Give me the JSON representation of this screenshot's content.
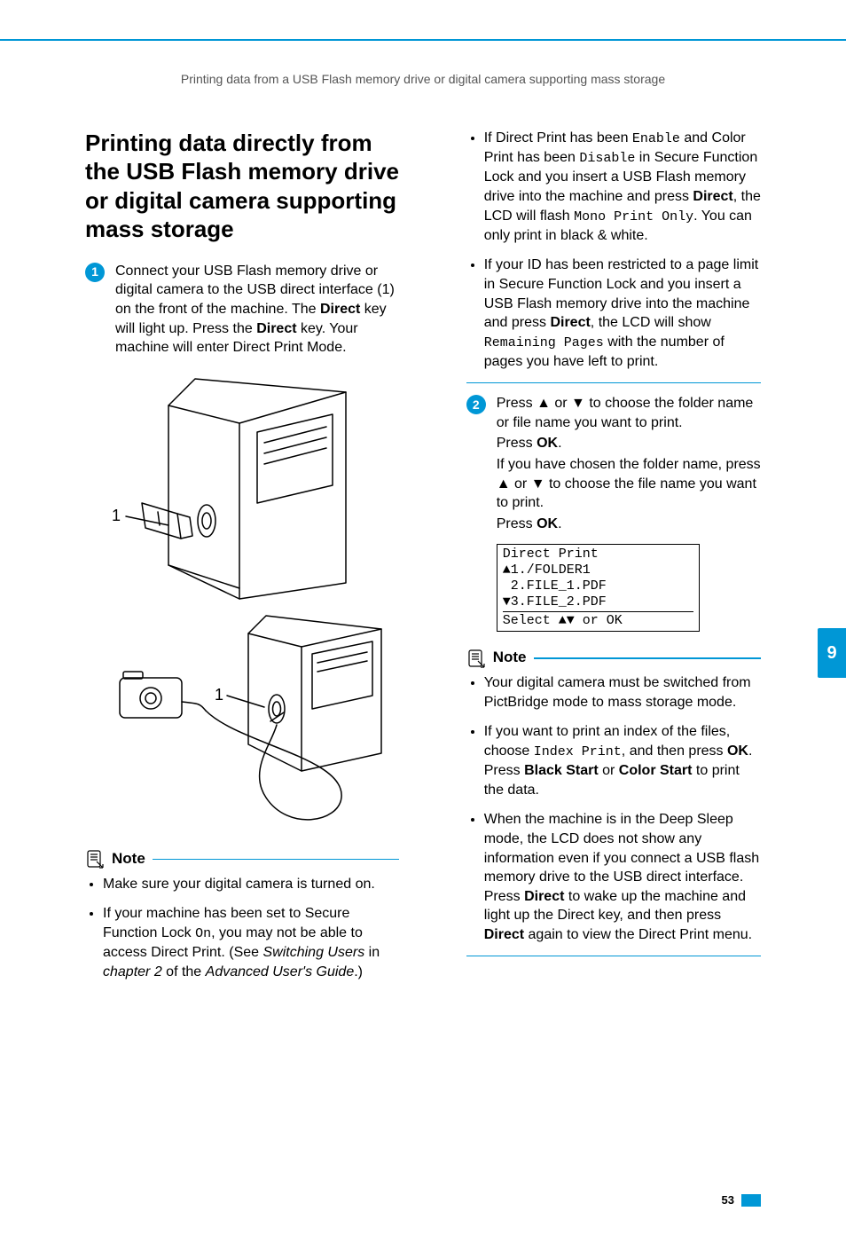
{
  "running_header": "Printing data from a USB Flash memory drive or digital camera supporting mass storage",
  "heading": "Printing data directly from the USB Flash memory drive or digital camera supporting mass storage",
  "step1_a": "Connect your USB Flash memory drive or digital camera to the USB direct interface (1) on the front of the machine. The ",
  "step1_b1": "Direct",
  "step1_c": " key will light up. Press the ",
  "step1_b2": "Direct",
  "step1_d": " key. Your machine will enter Direct Print Mode.",
  "callout_one_a": "1",
  "callout_one_b": "1",
  "note_label": "Note",
  "left_note_b1": "Make sure your digital camera is turned on.",
  "left_note_b2_a": "If your machine has been set to Secure Function Lock ",
  "left_note_b2_on": "On",
  "left_note_b2_b": ", you may not be able to access Direct Print. (See ",
  "left_note_b2_italic1": "Switching Users",
  "left_note_b2_c": " in ",
  "left_note_b2_italic2": "chapter 2",
  "left_note_b2_d": " of the ",
  "left_note_b2_italic3": "Advanced User's Guide",
  "left_note_b2_end": ".)",
  "right_b1_a": "If Direct Print has been ",
  "right_b1_enable": "Enable",
  "right_b1_b": " and Color Print has been ",
  "right_b1_disable": "Disable",
  "right_b1_c": " in Secure Function Lock and you insert a USB Flash memory drive into the machine and press ",
  "right_b1_direct": "Direct",
  "right_b1_d": ", the LCD will flash ",
  "right_b1_mono": "Mono Print Only",
  "right_b1_e": ". You can only print in black & white.",
  "right_b2_a": "If your ID has been restricted to a page limit in Secure Function Lock and you insert a USB Flash memory drive into the machine and press ",
  "right_b2_direct": "Direct",
  "right_b2_b": ", the LCD will show ",
  "right_b2_remain": "Remaining Pages",
  "right_b2_c": " with the number of pages you have left to print.",
  "step2_a": "Press ",
  "step2_up": "a",
  "step2_or1": " or ",
  "step2_down": "b",
  "step2_b": " to choose the folder name or file name you want to print.",
  "step2_press": "Press ",
  "step2_ok": "OK",
  "step2_dot": ".",
  "step2_c": "If you have chosen the folder name, press ",
  "step2_up2": "a",
  "step2_or2": " or ",
  "step2_down2": "b",
  "step2_d": " to choose the file name you want to print.",
  "lcd_l1": "Direct Print",
  "lcd_l2": "▲1./FOLDER1",
  "lcd_l3": " 2.FILE_1.PDF",
  "lcd_l4": "▼3.FILE_2.PDF",
  "lcd_l5": "Select ▲▼ or OK",
  "rnote_b1": "Your digital camera must be switched from PictBridge mode to mass storage mode.",
  "rnote_b2_a": "If you want to print an index of the files, choose ",
  "rnote_b2_idx": "Index Print",
  "rnote_b2_b": ", and then press ",
  "rnote_b2_ok": "OK",
  "rnote_b2_c": ". Press ",
  "rnote_b2_bs": "Black Start",
  "rnote_b2_or": " or ",
  "rnote_b2_cs": "Color Start",
  "rnote_b2_d": " to print the data.",
  "rnote_b3_a": "When the machine is in the Deep Sleep mode, the LCD does not show any information even if you connect a USB flash memory drive to the USB direct interface. Press ",
  "rnote_b3_d1": "Direct",
  "rnote_b3_b": " to wake up the machine and light up the Direct key, and then press ",
  "rnote_b3_d2": "Direct",
  "rnote_b3_c": " again to view the Direct Print menu.",
  "chapter_tab": "9",
  "page_number": "53"
}
